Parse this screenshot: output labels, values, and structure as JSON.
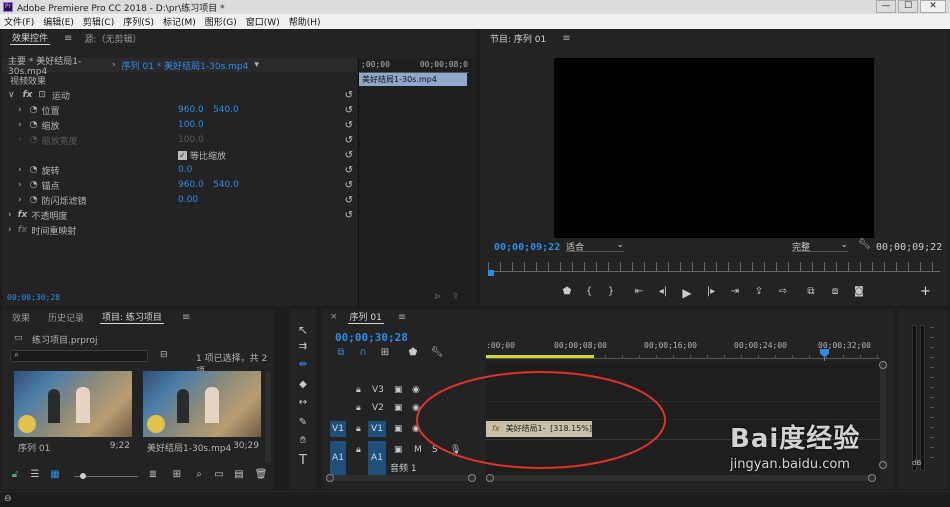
{
  "window": {
    "title": "Adobe Premiere Pro CC 2018 - D:\\pr\\练习项目 *",
    "controls": [
      "—",
      "☐",
      "✕"
    ]
  },
  "menu": [
    "文件(F)",
    "编辑(E)",
    "剪辑(C)",
    "序列(S)",
    "标记(M)",
    "图形(G)",
    "窗口(W)",
    "帮助(H)"
  ],
  "effect_controls": {
    "tabs": [
      "效果控件",
      "源:（无剪辑）"
    ],
    "master_label": "主要 * 美好结局1-30s.mp4",
    "sequence_label": "序列 01 * 美好结局1-30s.mp4",
    "mini_time_start": ";00;00",
    "mini_time_end": "00;00;08;0",
    "clip_name": "美好结局1-30s.mp4",
    "section_video": "视频效果",
    "motion": "运动",
    "props": [
      {
        "name": "位置",
        "v1": "960.0",
        "v2": "540.0"
      },
      {
        "name": "缩放",
        "v1": "100.0",
        "v2": ""
      },
      {
        "name": "缩放宽度",
        "v1": "100.0",
        "v2": ""
      },
      {
        "name": "等比缩放",
        "v1": "",
        "v2": ""
      },
      {
        "name": "旋转",
        "v1": "0.0",
        "v2": ""
      },
      {
        "name": "锚点",
        "v1": "960.0",
        "v2": "540.0"
      },
      {
        "name": "防闪烁滤镜",
        "v1": "0.00",
        "v2": ""
      }
    ],
    "opacity": "不透明度",
    "time_remap": "时间重映射",
    "timecode": "00;00;30;28"
  },
  "program": {
    "title": "节目: 序列 01",
    "timecode_left": "00;00;09;22",
    "fit": "适合",
    "quality": "完整",
    "timecode_right": "00;00;09;22"
  },
  "project": {
    "tabs": [
      "效果",
      "历史记录",
      "项目: 练习项目"
    ],
    "file": "练习项目.prproj",
    "selection": "1 项已选择，共 2 项",
    "items": [
      {
        "name": "序列 01",
        "duration": "9;22"
      },
      {
        "name": "美好结局1-30s.mp4",
        "duration": "30;29"
      }
    ]
  },
  "timeline": {
    "tab": "序列 01",
    "timecode": "00;00;30;28",
    "ruler": [
      ":00;00",
      "00;00;08;00",
      "00;00;16;00",
      "00;00;24;00",
      "00;00;32;00"
    ],
    "tracks": [
      {
        "name": "V3",
        "src": ""
      },
      {
        "name": "V2",
        "src": ""
      },
      {
        "name": "V1",
        "src": "V1"
      },
      {
        "name": "A1",
        "src": "A1"
      }
    ],
    "audio_label": "音频 1",
    "clip_name": "美好结局1-30s.mp4",
    "clip_speed": "[318.15%]"
  },
  "audio_meter": {
    "db_label": "dB"
  },
  "watermark": {
    "brand": "Bai度经验",
    "url": "jingyan.baidu.com"
  },
  "colors": {
    "accent": "#2d8ceb",
    "panel": "#232323",
    "bg": "#1d1d1d",
    "selection": "#3c5f8c",
    "annotation": "#e2322d"
  }
}
